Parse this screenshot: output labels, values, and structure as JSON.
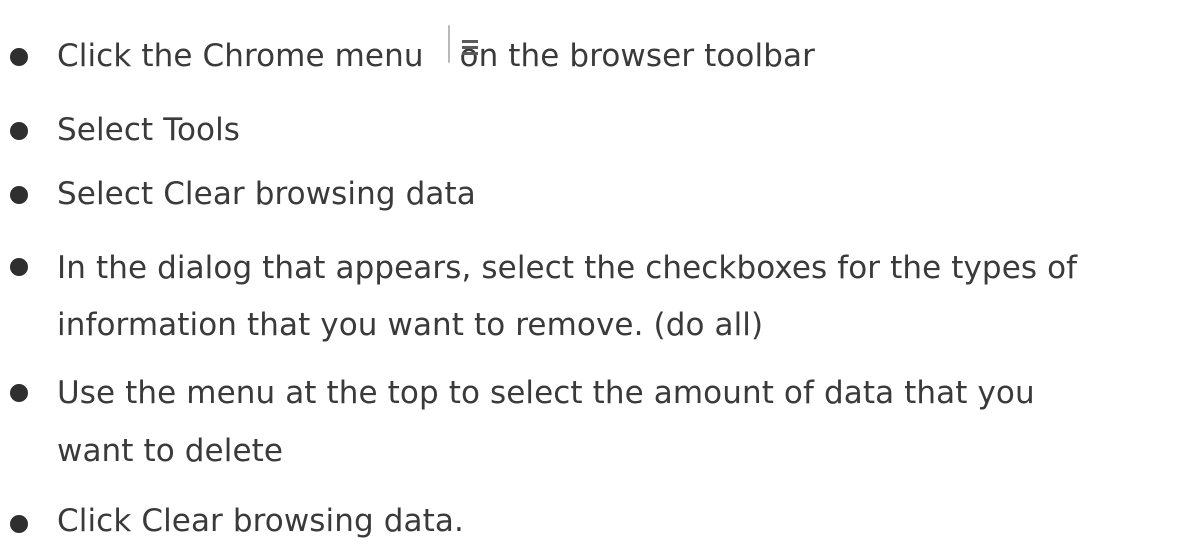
{
  "steps": [
    {
      "before": "Click the Chrome menu",
      "icon": "hamburger-menu-icon",
      "after": "on the browser toolbar"
    },
    {
      "text": "Select Tools"
    },
    {
      "text": "Select Clear browsing data"
    },
    {
      "line1": "In the dialog that appears, select the checkboxes for the types of",
      "line2": "information that you want to remove. (do all)"
    },
    {
      "line1": "Use the menu at the top to select the amount of data that you",
      "line2": "want to delete"
    },
    {
      "text": "Click Clear browsing data."
    }
  ],
  "colors": {
    "text": "#3a3a3a",
    "bullet": "#2f2f2f",
    "background": "#ffffff"
  }
}
